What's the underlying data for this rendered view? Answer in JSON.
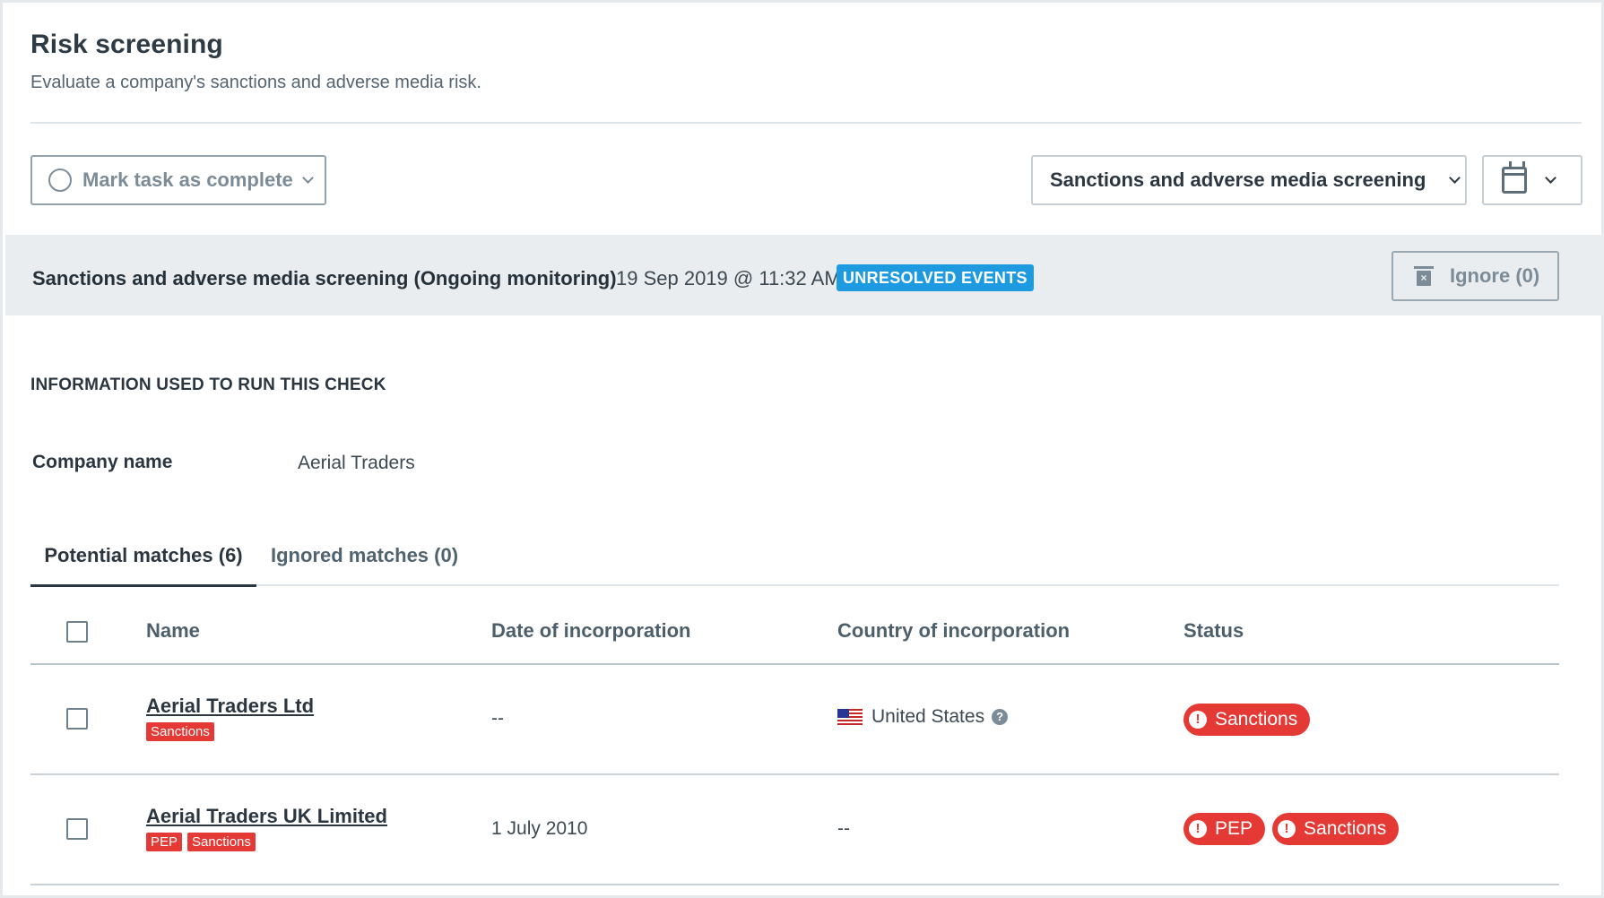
{
  "header": {
    "title": "Risk screening",
    "subtitle": "Evaluate a company's sanctions and adverse media risk."
  },
  "toolbar": {
    "mark_complete_label": "Mark task as complete",
    "screening_select_label": "Sanctions and adverse media screening"
  },
  "check": {
    "title": "Sanctions and adverse media screening (Ongoing monitoring)",
    "datetime": "19 Sep 2019 @ 11:32 AM",
    "badge": "UNRESOLVED EVENTS",
    "ignore_label": "Ignore (0)"
  },
  "info": {
    "heading": "INFORMATION USED TO RUN THIS CHECK",
    "company_label": "Company name",
    "company_value": "Aerial Traders"
  },
  "tabs": [
    {
      "label": "Potential matches (6)",
      "active": true
    },
    {
      "label": "Ignored matches (0)",
      "active": false
    }
  ],
  "table": {
    "columns": [
      "Name",
      "Date of incorporation",
      "Country of incorporation",
      "Status"
    ],
    "rows": [
      {
        "name": "Aerial Traders Ltd",
        "tags": [
          "Sanctions"
        ],
        "date": "--",
        "country": "United States",
        "status": [
          "Sanctions"
        ]
      },
      {
        "name": "Aerial Traders UK Limited",
        "tags": [
          "PEP",
          "Sanctions"
        ],
        "date": "1 July 2010",
        "country": "--",
        "status": [
          "PEP",
          "Sanctions"
        ]
      }
    ]
  },
  "colors": {
    "accent_blue": "#1e9be0",
    "alert_red": "#e53935",
    "band_gray": "#e9edf0"
  },
  "icons": {
    "mark_complete": "circle-icon",
    "calendar": "calendar-icon",
    "ignore": "trash-icon",
    "help": "question-icon",
    "alert": "exclamation-icon",
    "flag": "us-flag-icon"
  }
}
